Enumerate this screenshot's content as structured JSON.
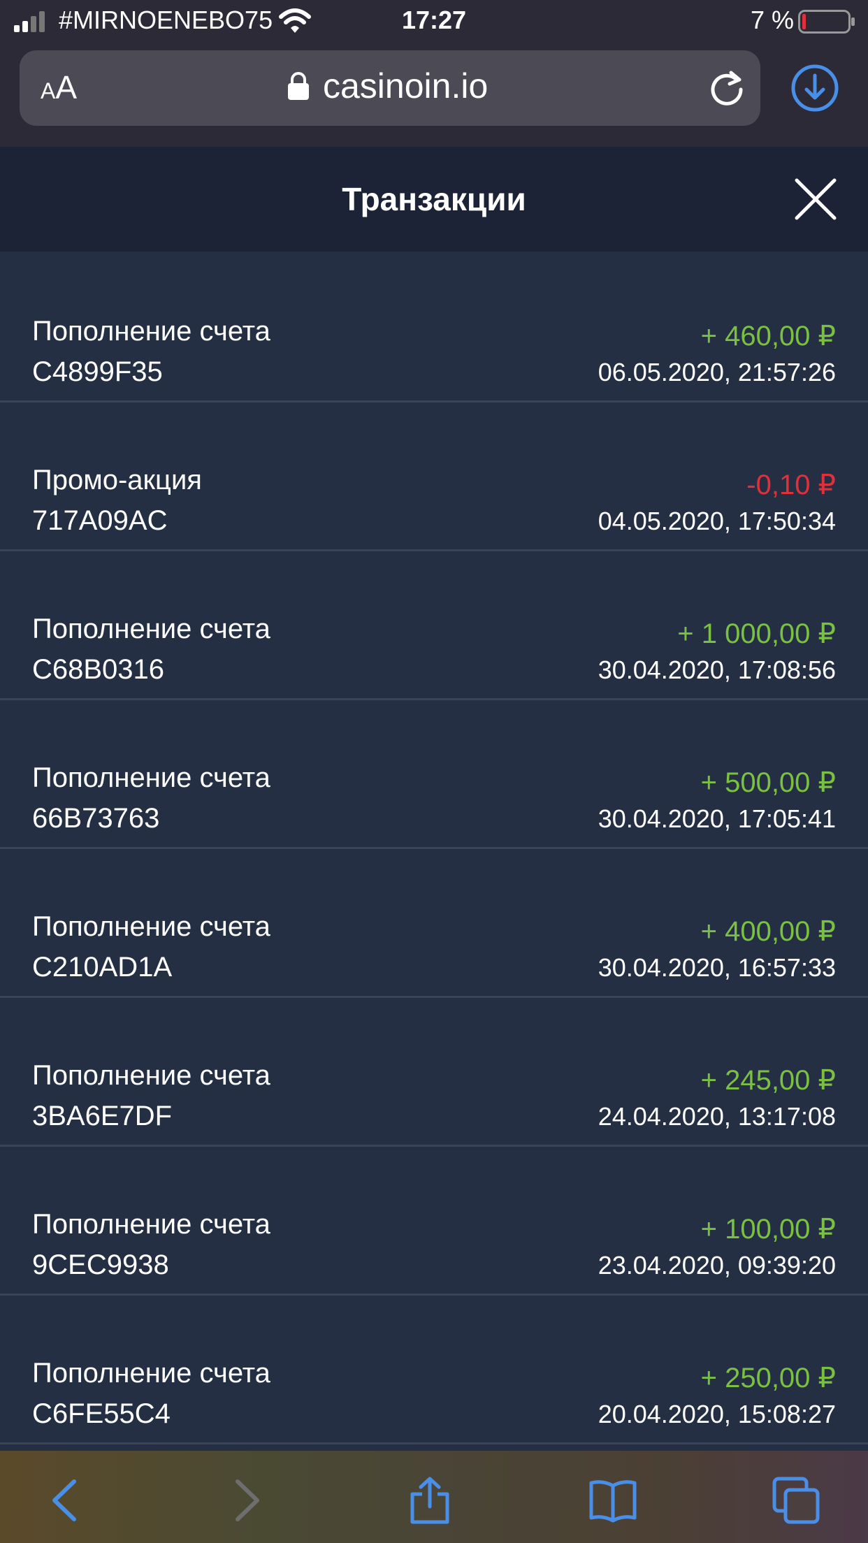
{
  "status": {
    "carrier": "#MIRNOENEBO75",
    "time": "17:27",
    "battery": "7 %",
    "battery_level": 0.07
  },
  "browser": {
    "text_size_label": "AA",
    "domain": "casinoin.io"
  },
  "header": {
    "title": "Транзакции"
  },
  "transactions": [
    {
      "label": "Пополнение счета",
      "code": "C4899F35",
      "amount": "+ 460,00 ₽",
      "date": "06.05.2020, 21:57:26",
      "type": "credit"
    },
    {
      "label": "Промо-акция",
      "code": "717A09AC",
      "amount": "-0,10 ₽",
      "date": "04.05.2020, 17:50:34",
      "type": "debit"
    },
    {
      "label": "Пополнение счета",
      "code": "C68B0316",
      "amount": "+ 1 000,00 ₽",
      "date": "30.04.2020, 17:08:56",
      "type": "credit"
    },
    {
      "label": "Пополнение счета",
      "code": "66B73763",
      "amount": "+ 500,00 ₽",
      "date": "30.04.2020, 17:05:41",
      "type": "credit"
    },
    {
      "label": "Пополнение счета",
      "code": "C210AD1A",
      "amount": "+ 400,00 ₽",
      "date": "30.04.2020, 16:57:33",
      "type": "credit"
    },
    {
      "label": "Пополнение счета",
      "code": "3BA6E7DF",
      "amount": "+ 245,00 ₽",
      "date": "24.04.2020, 13:17:08",
      "type": "credit"
    },
    {
      "label": "Пополнение счета",
      "code": "9CEC9938",
      "amount": "+ 100,00 ₽",
      "date": "23.04.2020, 09:39:20",
      "type": "credit"
    },
    {
      "label": "Пополнение счета",
      "code": "C6FE55C4",
      "amount": "+ 250,00 ₽",
      "date": "20.04.2020, 15:08:27",
      "type": "credit"
    }
  ],
  "colors": {
    "credit": "#7ac142",
    "debit": "#e0303b",
    "accent": "#4a8fe7"
  },
  "toolbar_icons": [
    "back-icon",
    "forward-icon",
    "share-icon",
    "bookmarks-icon",
    "tabs-icon"
  ]
}
